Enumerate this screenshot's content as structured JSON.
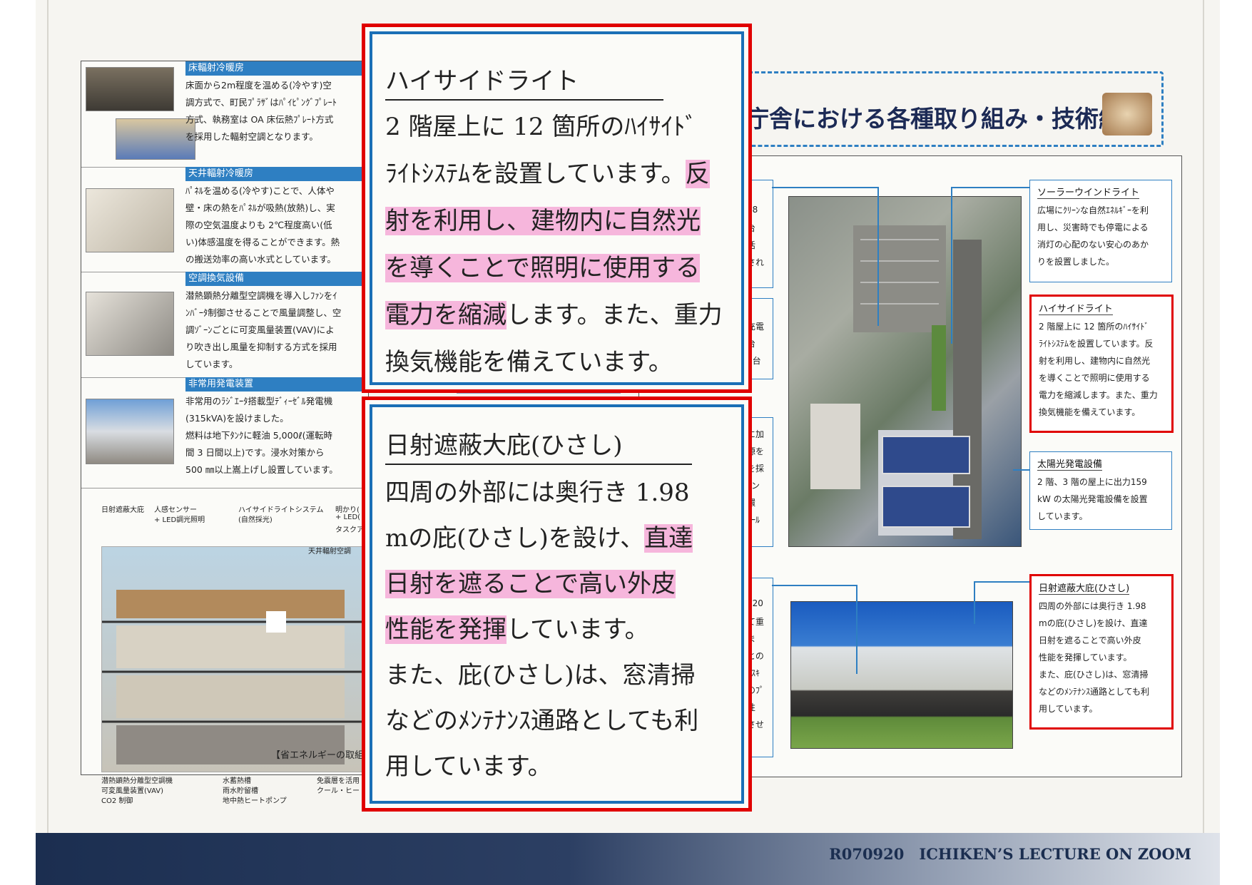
{
  "left_panel": {
    "rows": [
      {
        "heading": "床輻射冷暖房",
        "body": [
          "床面から2m程度を温める(冷やす)空",
          "調方式で、町民ﾌﾟﾗｻﾞはﾊﾟｲﾋﾟﾝｸﾞﾌﾟﾚｰﾄ",
          "方式、執務室は OA 床伝熱ﾌﾟﾚｰﾄ方式",
          "を採用した輻射空調となります。"
        ]
      },
      {
        "heading": "天井輻射冷暖房",
        "body": [
          "ﾊﾟﾈﾙを温める(冷やす)ことで、人体や",
          "壁・床の熱をﾊﾟﾈﾙが吸熱(放熱)し、実",
          "際の空気温度よりも 2℃程度高い(低",
          "い)体感温度を得ることができます。熱",
          "の搬送効率の高い水式としています。"
        ]
      },
      {
        "heading": "空調換気設備",
        "body": [
          "潜熱顕熱分離型空調機を導入しﾌｧﾝをｲ",
          "ﾝﾊﾞｰﾀ制御させることで風量調整し、空",
          "調ｿﾞｰﾝごとに可変風量装置(VAV)によ",
          "り吹き出し風量を抑制する方式を採用",
          "しています。"
        ]
      },
      {
        "heading": "非常用発電装置",
        "body": [
          "非常用のﾗｼﾞｴｰﾀ搭載型ﾃﾞｨｰｾﾞﾙ発電機",
          "(315kVA)を設けました。",
          "燃料は地下ﾀﾝｸに軽油 5,000ℓ(運転時",
          "間 3 日間以上)です。浸水対策から",
          "500 ㎜以上嵩上げし設置しています。"
        ]
      }
    ],
    "diagram_labels": [
      "日射遮蔽大庇",
      "人感センサー",
      "+ LED調光照明",
      "ハイサイドライトシステム",
      "(自然採光)",
      "明かり(",
      "+ LED(",
      "タスクア",
      "天井輻射空調",
      "潜熱顕熱分離型空調機",
      "可変風量装置(VAV)",
      "CO2 制御",
      "水蓄熱槽",
      "雨水貯留槽",
      "地中熱ヒートポンプ",
      "免震層を活用",
      "クール・ヒー"
    ],
    "caption": "【省エネルギーの取組"
  },
  "right_panel": {
    "title": "庁舎における各種取り組み・技術編",
    "left_edge_fragments": [
      "18",
      "台",
      "活",
      "され",
      "充電",
      "台",
      "4台",
      "に加",
      "源を",
      "を採",
      "ﾟン",
      "環",
      "ﾎｰﾙ",
      "120",
      "て重",
      "ま",
      "との",
      "ﾙｽｷ",
      "のﾌﾟ",
      "性",
      "させ"
    ],
    "callouts": [
      {
        "title": "ソーラーウインドライト",
        "lines": [
          "広場にｸﾘｰﾝな自然ｴﾈﾙｷﾞｰを利",
          "用し、災害時でも停電による",
          "消灯の心配のない安心のあか",
          "りを設置しました。"
        ]
      },
      {
        "title": "ハイサイドライト",
        "lines": [
          "2 階屋上に 12 箇所のﾊｲｻｲﾄﾞ",
          "ﾗｲﾄｼｽﾃﾑを設置しています。反",
          "射を利用し、建物内に自然光",
          "を導くことで照明に使用する",
          "電力を縮減します。また、重力",
          "換気機能を備えています。"
        ]
      },
      {
        "title": "太陽光発電設備",
        "lines": [
          "2 階、3 階の屋上に出力159",
          "kW の太陽光発電設備を設置",
          "しています。"
        ]
      },
      {
        "title": "日射遮蔽大庇(ひさし)",
        "lines": [
          "四周の外部には奥行き 1.98",
          "mの庇(ひさし)を設け、直達",
          "日射を遮ることで高い外皮",
          "性能を発揮しています。",
          "また、庇(ひさし)は、窓清掃",
          "などのﾒﾝﾃﾅﾝｽ通路としても利",
          "用しています。"
        ]
      }
    ]
  },
  "zoom_top": {
    "title": "ハイサイドライト",
    "line1": "2 階屋上に 12 箇所のﾊｲｻｲﾄﾞ",
    "line2_plain": "ﾗｲﾄｼｽﾃﾑを設置しています。",
    "line2_hl": "反",
    "line3_hl": "射を利用し、建物内に自然光",
    "line4_hl": "を導くことで照明に使用する",
    "line5_hl": "電力を縮減",
    "line5_plain": "します。また、重力",
    "line6": "換気機能を備えています。"
  },
  "zoom_bottom": {
    "title": "日射遮蔽大庇(ひさし)",
    "line1": "四周の外部には奥行き 1.98",
    "line2_plain": "mの庇(ひさし)を設け、",
    "line2_hl": "直達",
    "line3_hl": "日射を遮ることで高い外皮",
    "line4_hl": "性能を発揮",
    "line4_plain": "しています。",
    "line5": "また、庇(ひさし)は、窓清掃",
    "line6": "などのﾒﾝﾃﾅﾝｽ通路としても利",
    "line7": "用しています。"
  },
  "footer": {
    "text": "R070920　ICHIKEN’S LECTURE ON ZOOM"
  },
  "colors": {
    "accent_red": "#e00000",
    "accent_blue": "#1a6fb6",
    "highlight": "#f6b6dc",
    "footer_navy": "#1b2e50"
  }
}
